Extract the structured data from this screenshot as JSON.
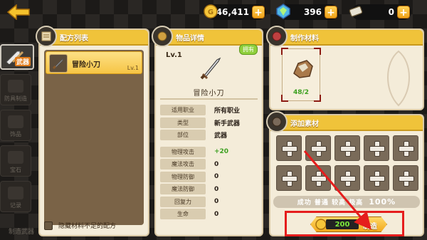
{
  "topbar": {
    "gold": "46,411",
    "gems": "396",
    "tickets": "0",
    "plus": "+"
  },
  "side_tabs": [
    {
      "label": "武器",
      "active": true
    },
    {
      "label": "防具制造",
      "active": false
    },
    {
      "label": "饰品",
      "active": false
    },
    {
      "label": "宝石",
      "active": false
    },
    {
      "label": "记录",
      "active": false
    }
  ],
  "bottom_label": "制造武器",
  "recipe_panel": {
    "title": "配方列表",
    "items": [
      {
        "name": "冒险小刀",
        "level": "Lv.1"
      }
    ],
    "hide_label": "隐藏材料不足的配方"
  },
  "detail_panel": {
    "title": "物品详情",
    "level": "Lv.1",
    "owned": "拥有",
    "item_name": "冒险小刀",
    "info": [
      {
        "key": "适用职业",
        "value": "所有职业"
      },
      {
        "key": "类型",
        "value": "新手武器"
      },
      {
        "key": "部位",
        "value": "武器"
      }
    ],
    "stats": [
      {
        "key": "物理攻击",
        "value": "+20",
        "highlight": true
      },
      {
        "key": "魔法攻击",
        "value": "0"
      },
      {
        "key": "物理防御",
        "value": "0"
      },
      {
        "key": "魔法防御",
        "value": "0"
      },
      {
        "key": "回复力",
        "value": "0"
      },
      {
        "key": "生命",
        "value": "0"
      }
    ]
  },
  "materials_panel": {
    "title": "制作材料",
    "items": [
      {
        "count": "48/2"
      }
    ]
  },
  "add_panel": {
    "title": "添加素材",
    "slots": 10,
    "rate_text": "成功 普通 较高 极高",
    "rate_pct": "100%",
    "cost": "200",
    "craft_label": "制造"
  },
  "colors": {
    "header": "#f0c33a",
    "panel_bg": "#f4ecd9",
    "annotation": "#e51d1d",
    "stat_green": "#3ca020"
  }
}
